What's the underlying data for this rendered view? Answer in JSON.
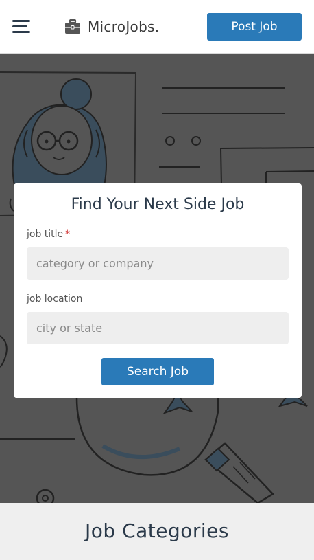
{
  "header": {
    "brand_name": "MicroJobs.",
    "post_job_label": "Post Job"
  },
  "search": {
    "title": "Find Your Next Side Job",
    "job_title_label": "job title",
    "required_mark": "*",
    "job_title_placeholder": "category or company",
    "job_location_label": "job location",
    "job_location_placeholder": "city or state",
    "search_button_label": "Search Job"
  },
  "categories": {
    "title": "Job Categories"
  },
  "colors": {
    "accent": "#2a7ab8",
    "hero_overlay": "#555555",
    "text_dark": "#2b3a4a",
    "required": "#d03030"
  },
  "icons": {
    "menu": "hamburger-icon",
    "brand": "briefcase-icon"
  }
}
